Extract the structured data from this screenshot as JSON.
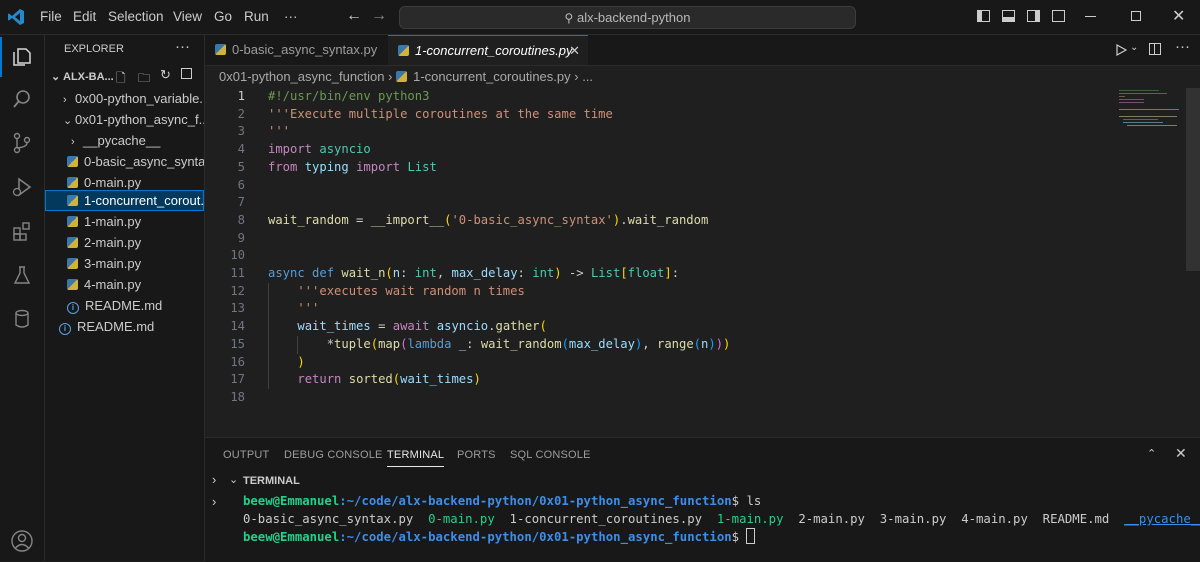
{
  "titlebar": {
    "menus": [
      "File",
      "Edit",
      "Selection",
      "View",
      "Go",
      "Run",
      "···"
    ],
    "search": "alx-backend-python"
  },
  "sidebar": {
    "title": "EXPLORER",
    "more": "···",
    "root": "ALX-BA...",
    "items": [
      {
        "label": "0x00-python_variable..."
      },
      {
        "label": "0x01-python_async_f..."
      },
      {
        "label": "__pycache__"
      },
      {
        "label": "0-basic_async_synta..."
      },
      {
        "label": "0-main.py"
      },
      {
        "label": "1-concurrent_corout..."
      },
      {
        "label": "1-main.py"
      },
      {
        "label": "2-main.py"
      },
      {
        "label": "3-main.py"
      },
      {
        "label": "4-main.py"
      },
      {
        "label": "README.md"
      },
      {
        "label": "README.md"
      }
    ]
  },
  "tabs": [
    {
      "label": "0-basic_async_syntax.py"
    },
    {
      "label": "1-concurrent_coroutines.py"
    }
  ],
  "breadcrumb": {
    "folder": "0x01-python_async_function",
    "file": "1-concurrent_coroutines.py",
    "more": "..."
  },
  "editor": {
    "line_numbers": [
      "1",
      "2",
      "3",
      "4",
      "5",
      "6",
      "7",
      "8",
      "9",
      "10",
      "11",
      "12",
      "13",
      "14",
      "15",
      "16",
      "17",
      "18"
    ],
    "lines": [
      "#!/usr/bin/env python3",
      "'''Execute multiple coroutines at the same time",
      "'''",
      "import asyncio",
      "from typing import List",
      "",
      "",
      "wait_random = __import__('0-basic_async_syntax').wait_random",
      "",
      "",
      "async def wait_n(n: int, max_delay: int) -> List[float]:",
      "    '''executes wait random n times",
      "    '''",
      "    wait_times = await asyncio.gather(",
      "        *tuple(map(lambda _: wait_random(max_delay), range(n)))",
      "    )",
      "    return sorted(wait_times)",
      ""
    ]
  },
  "panel": {
    "tabs": [
      "OUTPUT",
      "DEBUG CONSOLE",
      "TERMINAL",
      "PORTS",
      "SQL CONSOLE"
    ],
    "section": "TERMINAL",
    "terminal": {
      "user": "beew@Emmanuel",
      "path": ":~/code/alx-backend-python/0x01-python_async_function",
      "prompt": "$ ",
      "command": "ls",
      "files": [
        "0-basic_async_syntax.py",
        "0-main.py",
        "1-concurrent_coroutines.py",
        "1-main.py",
        "2-main.py",
        "3-main.py",
        "4-main.py",
        "README.md",
        "__pycache__"
      ]
    }
  },
  "colors": {
    "accent": "#0078d4",
    "selection": "#04395e",
    "terminal_green": "#23d18b",
    "terminal_blue": "#3b8eea"
  },
  "icons": [
    "vscode-logo-icon",
    "explorer-icon",
    "search-icon",
    "source-control-icon",
    "run-debug-icon",
    "extensions-icon",
    "testing-icon",
    "database-icon",
    "account-icon",
    "settings-icon"
  ]
}
